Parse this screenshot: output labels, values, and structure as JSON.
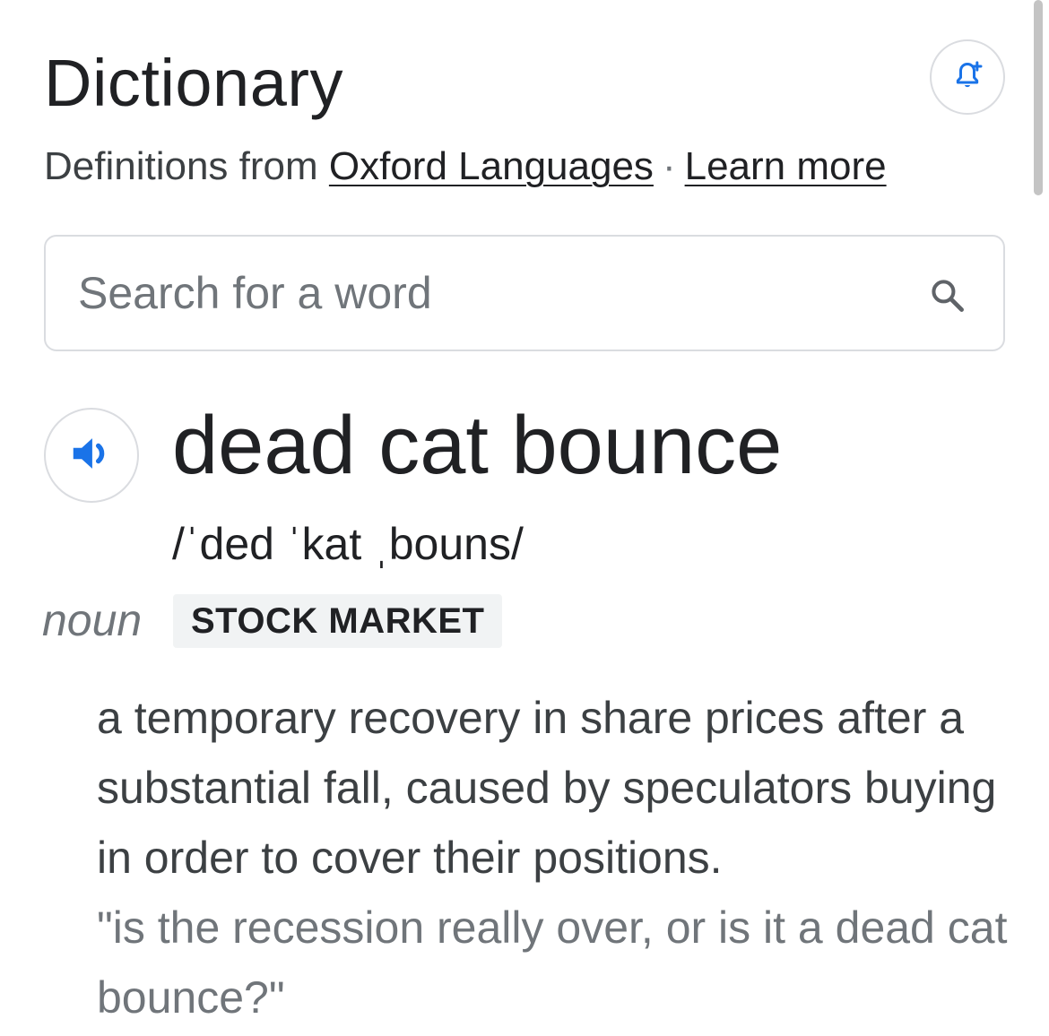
{
  "header": {
    "title": "Dictionary",
    "source_prefix": "Definitions from ",
    "source_link": "Oxford Languages",
    "separator": "·",
    "learn_more": "Learn more",
    "alert_icon": "add-alert-bell-icon"
  },
  "search": {
    "placeholder": "Search for a word",
    "value": "",
    "icon": "search-icon"
  },
  "entry": {
    "speaker_icon": "volume-up-icon",
    "word": "dead cat bounce",
    "phonetic": "/ˈded ˈkat ˌbouns/",
    "part_of_speech": "noun",
    "domain_label": "STOCK MARKET",
    "definition": "a temporary recovery in share prices after a substantial fall, caused by speculators buying in order to cover their positions.",
    "example": "\"is the recession really over, or is it a dead cat bounce?\""
  },
  "colors": {
    "accent_blue": "#1a73e8",
    "text_primary": "#202124",
    "text_secondary": "#70757a",
    "border": "#dadce0",
    "tag_background": "#f1f3f4"
  }
}
